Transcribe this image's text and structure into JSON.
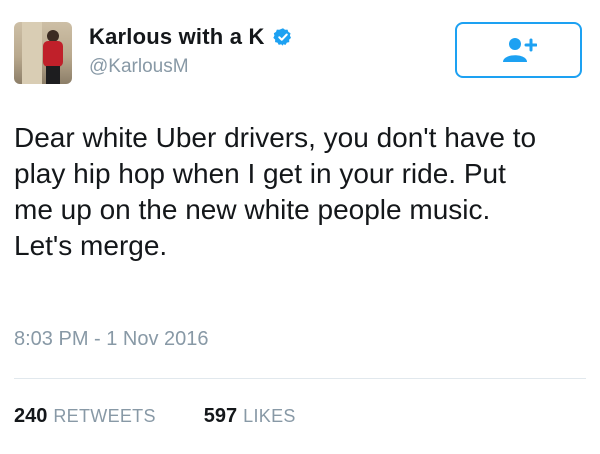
{
  "tweet": {
    "author": {
      "display_name": "Karlous with a K",
      "handle": "@KarlousM",
      "verified": true,
      "avatar_icon": "profile-photo"
    },
    "follow_button": {
      "icon": "add-user-icon",
      "color": "#1da1f2"
    },
    "text_lines": [
      "Dear white Uber drivers, you don't have to",
      "play hip hop when I get in your ride. Put",
      "me up on the new white people music.",
      "Let's merge."
    ],
    "timestamp": "8:03 PM - 1 Nov 2016",
    "stats": {
      "retweets": {
        "count": "240",
        "label": "RETWEETS"
      },
      "likes": {
        "count": "597",
        "label": "LIKES"
      }
    }
  },
  "colors": {
    "accent": "#1da1f2",
    "muted": "#8899a6",
    "text": "#14171a",
    "divider": "#e1e8ed"
  }
}
